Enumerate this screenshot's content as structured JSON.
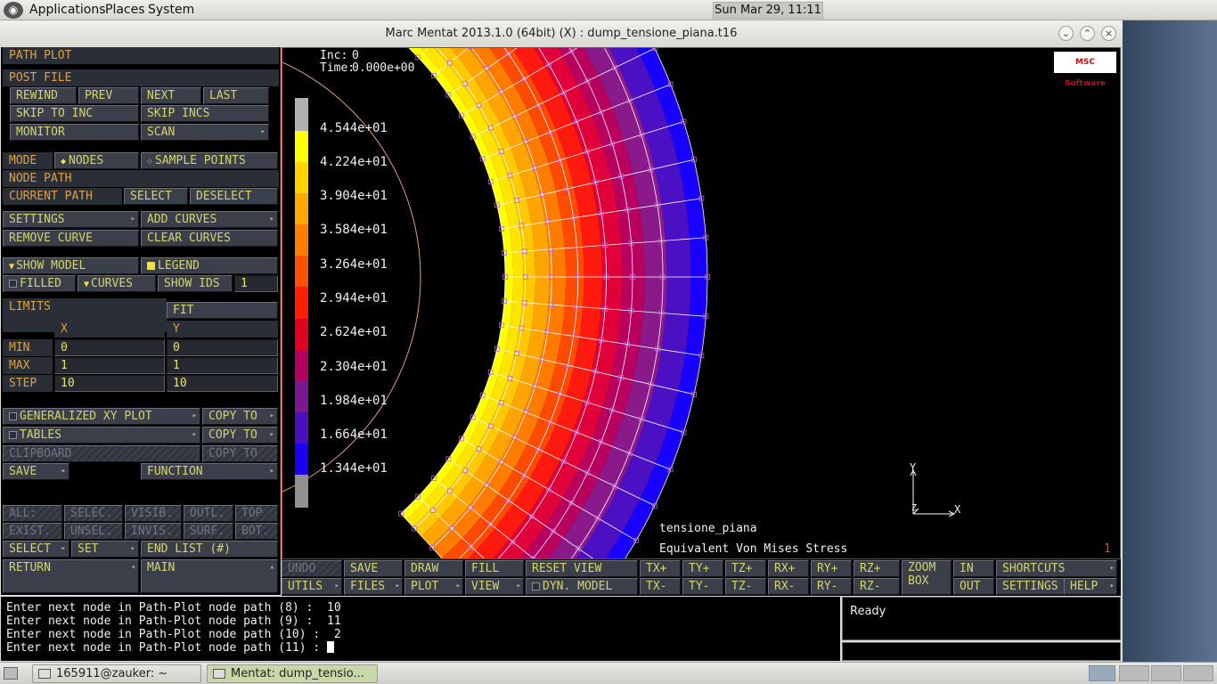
{
  "topbar": {
    "menus": [
      "Applications",
      "Places",
      "System"
    ],
    "clock": "Sun Mar 29, 11:11"
  },
  "window": {
    "title": "Marc Mentat 2013.1.0 (64bit) (X) : dump_tensione_piana.t16"
  },
  "panel": {
    "header": "PATH PLOT",
    "post_file": "POST FILE",
    "rewind": "REWIND",
    "prev": "PREV",
    "next": "NEXT",
    "last": "LAST",
    "skip_to_inc": "SKIP TO INC",
    "skip_incs": "SKIP INCS",
    "monitor": "MONITOR",
    "scan": "SCAN",
    "mode": "MODE",
    "nodes": "NODES",
    "sample_points": "SAMPLE POINTS",
    "node_path": "NODE PATH",
    "current_path": "CURRENT PATH",
    "select": "SELECT",
    "deselect": "DESELECT",
    "settings": "SETTINGS",
    "add_curves": "ADD CURVES",
    "remove_curve": "REMOVE CURVE",
    "clear_curves": "CLEAR CURVES",
    "show_model": "SHOW MODEL",
    "legend": "LEGEND",
    "filled": "FILLED",
    "curves": "CURVES",
    "show_ids": "SHOW IDS",
    "show_ids_value": "1",
    "limits": "LIMITS",
    "fit": "FIT",
    "col_x": "X",
    "col_y": "Y",
    "min": "MIN",
    "max": "MAX",
    "step": "STEP",
    "min_x": "0",
    "min_y": "0",
    "max_x": "1",
    "max_y": "1",
    "step_x": "10",
    "step_y": "10",
    "gen_xy_plot": "GENERALIZED XY PLOT",
    "tables": "TABLES",
    "clipboard": "CLIPBOARD",
    "copy_to": "COPY TO",
    "save": "SAVE",
    "function": "FUNCTION",
    "sel_all": "ALL:",
    "selec": "SELEC.",
    "visib": "VISIB.",
    "outl": "OUTL.",
    "top": "TOP",
    "exist": "EXIST.",
    "unsel": "UNSEL.",
    "invis": "INVIS.",
    "surf": "SURF.",
    "bot": "BOT.",
    "select_btn": "SELECT",
    "set": "SET",
    "end_list": "END LIST (#)",
    "return": "RETURN",
    "main": "MAIN"
  },
  "viewport": {
    "inc_label": "Inc:",
    "inc_value": "0",
    "time_label": "Time:",
    "time_value": "0.000e+00",
    "legend_values": [
      "4.544e+01",
      "4.224e+01",
      "3.904e+01",
      "3.584e+01",
      "3.264e+01",
      "2.944e+01",
      "2.624e+01",
      "2.304e+01",
      "1.984e+01",
      "1.664e+01",
      "1.344e+01"
    ],
    "legend_colors": [
      "#ffff00",
      "#ffd200",
      "#ffa800",
      "#ff7e00",
      "#ff5200",
      "#ff1e00",
      "#e00020",
      "#b00060",
      "#7a1890",
      "#4a10c0",
      "#1a00f0"
    ],
    "model_name": "tensione_piana",
    "result_name": "Equivalent Von Mises Stress",
    "frame_no": "1",
    "axis_x": "X",
    "axis_y": "Y",
    "logo": "MSC Software"
  },
  "toolbar": {
    "undo": "UNDO",
    "save": "SAVE",
    "draw": "DRAW",
    "fill": "FILL",
    "reset_view": "RESET VIEW",
    "tx_plus": "TX+",
    "ty_plus": "TY+",
    "tz_plus": "TZ+",
    "rx_plus": "RX+",
    "ry_plus": "RY+",
    "rz_plus": "RZ+",
    "zoom": "ZOOM",
    "box": "BOX",
    "in": "IN",
    "shortcuts": "SHORTCUTS",
    "utils": "UTILS",
    "files": "FILES",
    "plot": "PLOT",
    "view": "VIEW",
    "dyn_model": "DYN. MODEL",
    "tx_minus": "TX-",
    "ty_minus": "TY-",
    "tz_minus": "TZ-",
    "rx_minus": "RX-",
    "ry_minus": "RY-",
    "rz_minus": "RZ-",
    "out": "OUT",
    "settings": "SETTINGS",
    "help": "HELP"
  },
  "console": {
    "lines": [
      "Enter next node in Path-Plot node path (8) :  10",
      "Enter next node in Path-Plot node path (9) :  11",
      "Enter next node in Path-Plot node path (10) :  2",
      "Enter next node in Path-Plot node path (11) : "
    ],
    "status": "Ready"
  },
  "taskbar": {
    "items": [
      "165911@zauker: ~",
      "Mentat: dump_tensio..."
    ]
  }
}
